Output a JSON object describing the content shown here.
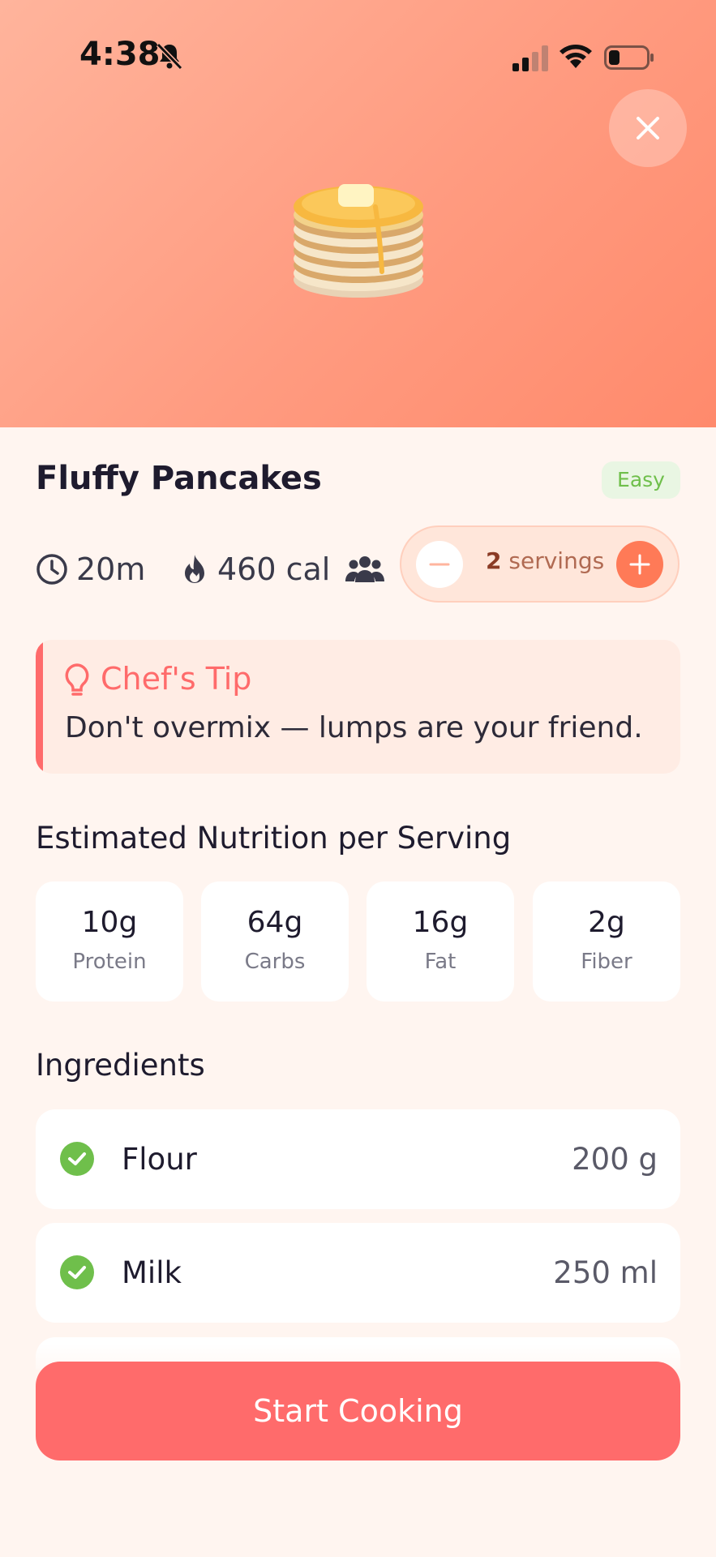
{
  "status_bar": {
    "time": "4:38",
    "icons": [
      "bell-slash-icon",
      "signal-icon",
      "wifi-icon",
      "battery-icon"
    ]
  },
  "hero": {
    "emoji": "🥞",
    "icon": "pancakes-icon",
    "close_icon": "close-icon",
    "gradient_colors": [
      "#ffb49c",
      "#ff8a6c"
    ]
  },
  "recipe": {
    "title": "Fluffy Pancakes",
    "difficulty": "Easy",
    "time": "20m",
    "calories": "460 cal",
    "servings": {
      "count": "2",
      "label": "servings"
    }
  },
  "tip": {
    "title": "Chef's Tip",
    "text": "Don't overmix — lumps are your friend.",
    "icon": "lightbulb-icon"
  },
  "nutrition": {
    "title": "Estimated Nutrition per Serving",
    "items": [
      {
        "value": "10g",
        "label": "Protein"
      },
      {
        "value": "64g",
        "label": "Carbs"
      },
      {
        "value": "16g",
        "label": "Fat"
      },
      {
        "value": "2g",
        "label": "Fiber"
      }
    ]
  },
  "ingredients": {
    "title": "Ingredients",
    "items": [
      {
        "name": "Flour",
        "amount": "200 g",
        "checked": true
      },
      {
        "name": "Milk",
        "amount": "250 ml",
        "checked": true
      }
    ]
  },
  "cta": {
    "label": "Start Cooking"
  },
  "colors": {
    "accent": "#ff6b6b",
    "orange": "#ff7a57",
    "green": "#6fbf4b",
    "background": "#fff5f0"
  }
}
